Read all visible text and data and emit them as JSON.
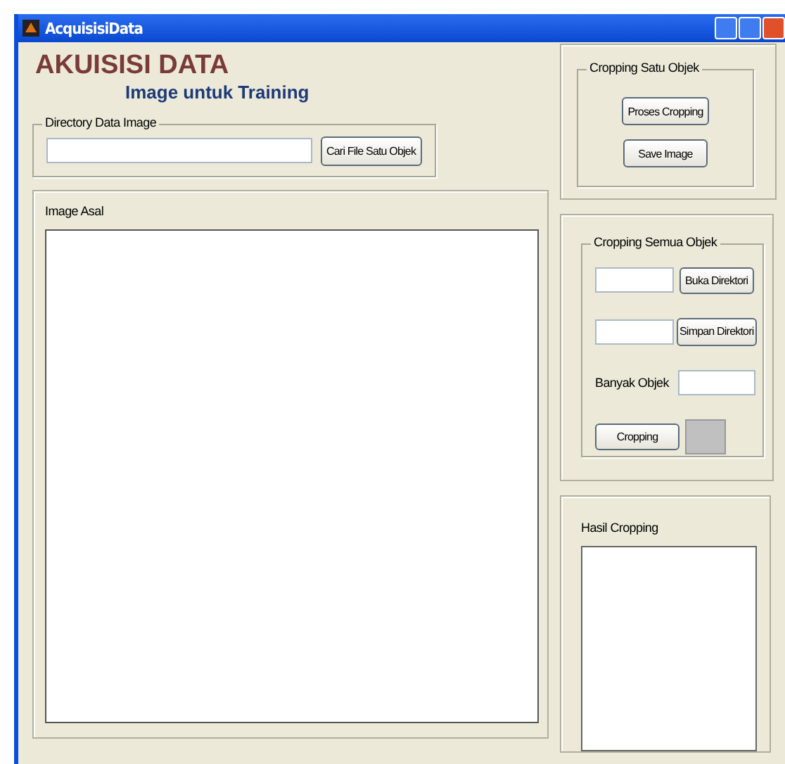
{
  "window": {
    "title": "AcquisisiData"
  },
  "heading": {
    "title": "AKUISISI DATA",
    "subtitle": "Image untuk Training"
  },
  "directory_group": {
    "label": "Directory Data Image",
    "button": "Cari File Satu Objek"
  },
  "image_panel": {
    "label": "Image Asal"
  },
  "single_group": {
    "label": "Cropping Satu Objek",
    "buttons": [
      "Proses Cropping",
      "Save Image"
    ]
  },
  "all_group": {
    "label": "Cropping Semua Objek",
    "open_button": "Buka Direktori",
    "save_button": "Simpan Direktori",
    "count_label": "Banyak Objek",
    "crop_button": "Cropping"
  },
  "result_panel": {
    "label": "Hasil Cropping"
  }
}
